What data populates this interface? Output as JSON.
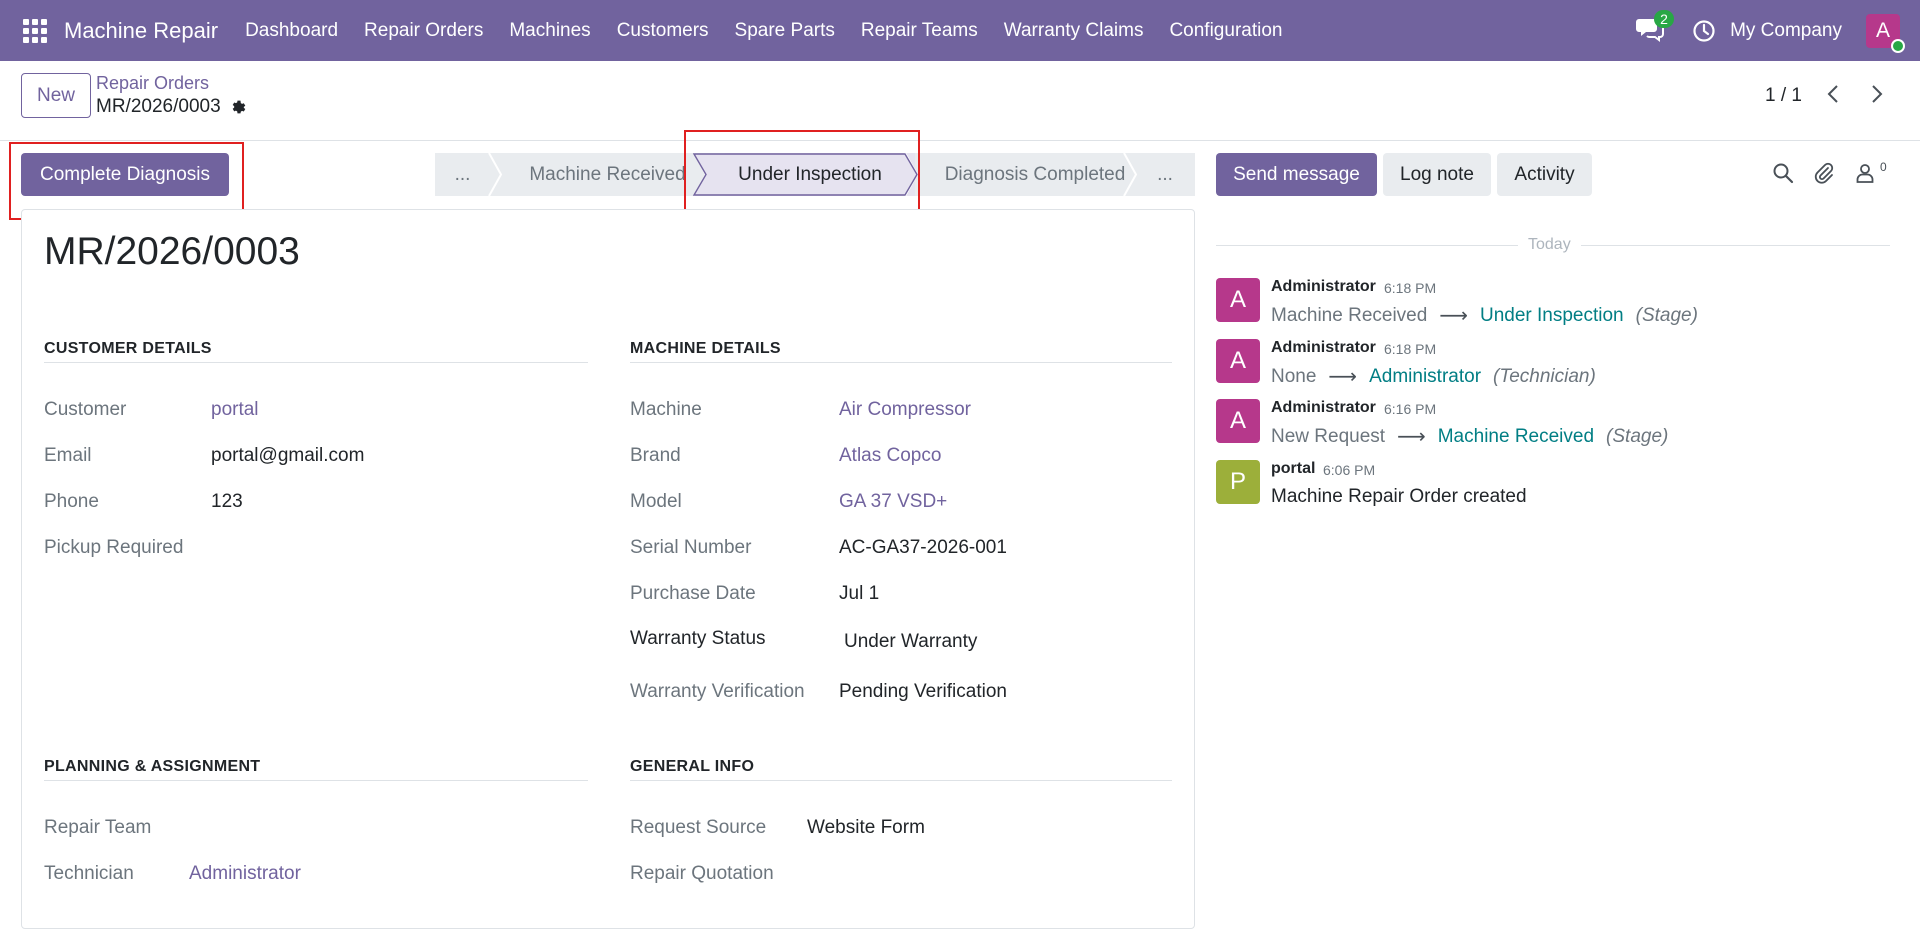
{
  "navbar": {
    "app_name": "Machine Repair",
    "menu": [
      "Dashboard",
      "Repair Orders",
      "Machines",
      "Customers",
      "Spare Parts",
      "Repair Teams",
      "Warranty Claims",
      "Configuration"
    ],
    "chat_count": "2",
    "company": "My Company",
    "avatar_letter": "A",
    "bg_color": "#71639e"
  },
  "control": {
    "new_label": "New",
    "breadcrumb_parent": "Repair Orders",
    "breadcrumb_current": "MR/2026/0003",
    "pager": "1 / 1"
  },
  "actions": {
    "primary_label": "Complete Diagnosis"
  },
  "statusbar": {
    "stages": [
      {
        "label": "...",
        "active": false
      },
      {
        "label": "Machine Received",
        "active": false
      },
      {
        "label": "Under Inspection",
        "active": true
      },
      {
        "label": "Diagnosis Completed",
        "active": false
      },
      {
        "label": "...",
        "active": false
      }
    ]
  },
  "form": {
    "title": "MR/2026/0003",
    "customer_section": {
      "title": "CUSTOMER DETAILS",
      "fields": [
        {
          "label": "Customer",
          "value": "portal"
        },
        {
          "label": "Email",
          "value": "portal@gmail.com"
        },
        {
          "label": "Phone",
          "value": "123"
        },
        {
          "label": "Pickup Required",
          "value": ""
        }
      ]
    },
    "machine_section": {
      "title": "MACHINE DETAILS",
      "fields": [
        {
          "label": "Machine",
          "value": "Air Compressor"
        },
        {
          "label": "Brand",
          "value": "Atlas Copco"
        },
        {
          "label": "Model",
          "value": "GA 37 VSD+"
        },
        {
          "label": "Serial Number",
          "value": "AC-GA37-2026-001"
        },
        {
          "label": "Purchase Date",
          "value": "Jul 1"
        },
        {
          "label": "Warranty Status",
          "value": "Under Warranty"
        },
        {
          "label": "Warranty Verification",
          "value": "Pending Verification"
        }
      ]
    },
    "planning_section": {
      "title": "PLANNING & ASSIGNMENT",
      "fields": [
        {
          "label": "Repair Team",
          "value": ""
        },
        {
          "label": "Technician",
          "value": "Administrator"
        }
      ]
    },
    "general_section": {
      "title": "GENERAL INFO",
      "fields": [
        {
          "label": "Request Source",
          "value": "Website Form"
        },
        {
          "label": "Repair Quotation",
          "value": ""
        }
      ]
    }
  },
  "chatter": {
    "send_message": "Send message",
    "log_note": "Log note",
    "activity": "Activity",
    "follower_count": "0",
    "today": "Today",
    "messages": [
      {
        "avatar": "A",
        "avatar_color": "#b6388b",
        "author": "Administrator",
        "time": "6:18 PM",
        "from": "Machine Received",
        "to": "Under Inspection",
        "field": "(Stage)"
      },
      {
        "avatar": "A",
        "avatar_color": "#b6388b",
        "author": "Administrator",
        "time": "6:18 PM",
        "from": "None",
        "to": "Administrator",
        "field": "(Technician)"
      },
      {
        "avatar": "A",
        "avatar_color": "#b6388b",
        "author": "Administrator",
        "time": "6:16 PM",
        "from": "New Request",
        "to": "Machine Received",
        "field": "(Stage)"
      },
      {
        "avatar": "P",
        "avatar_color": "#9caf3a",
        "author": "portal",
        "time": "6:06 PM",
        "text": "Machine Repair Order created"
      }
    ]
  }
}
